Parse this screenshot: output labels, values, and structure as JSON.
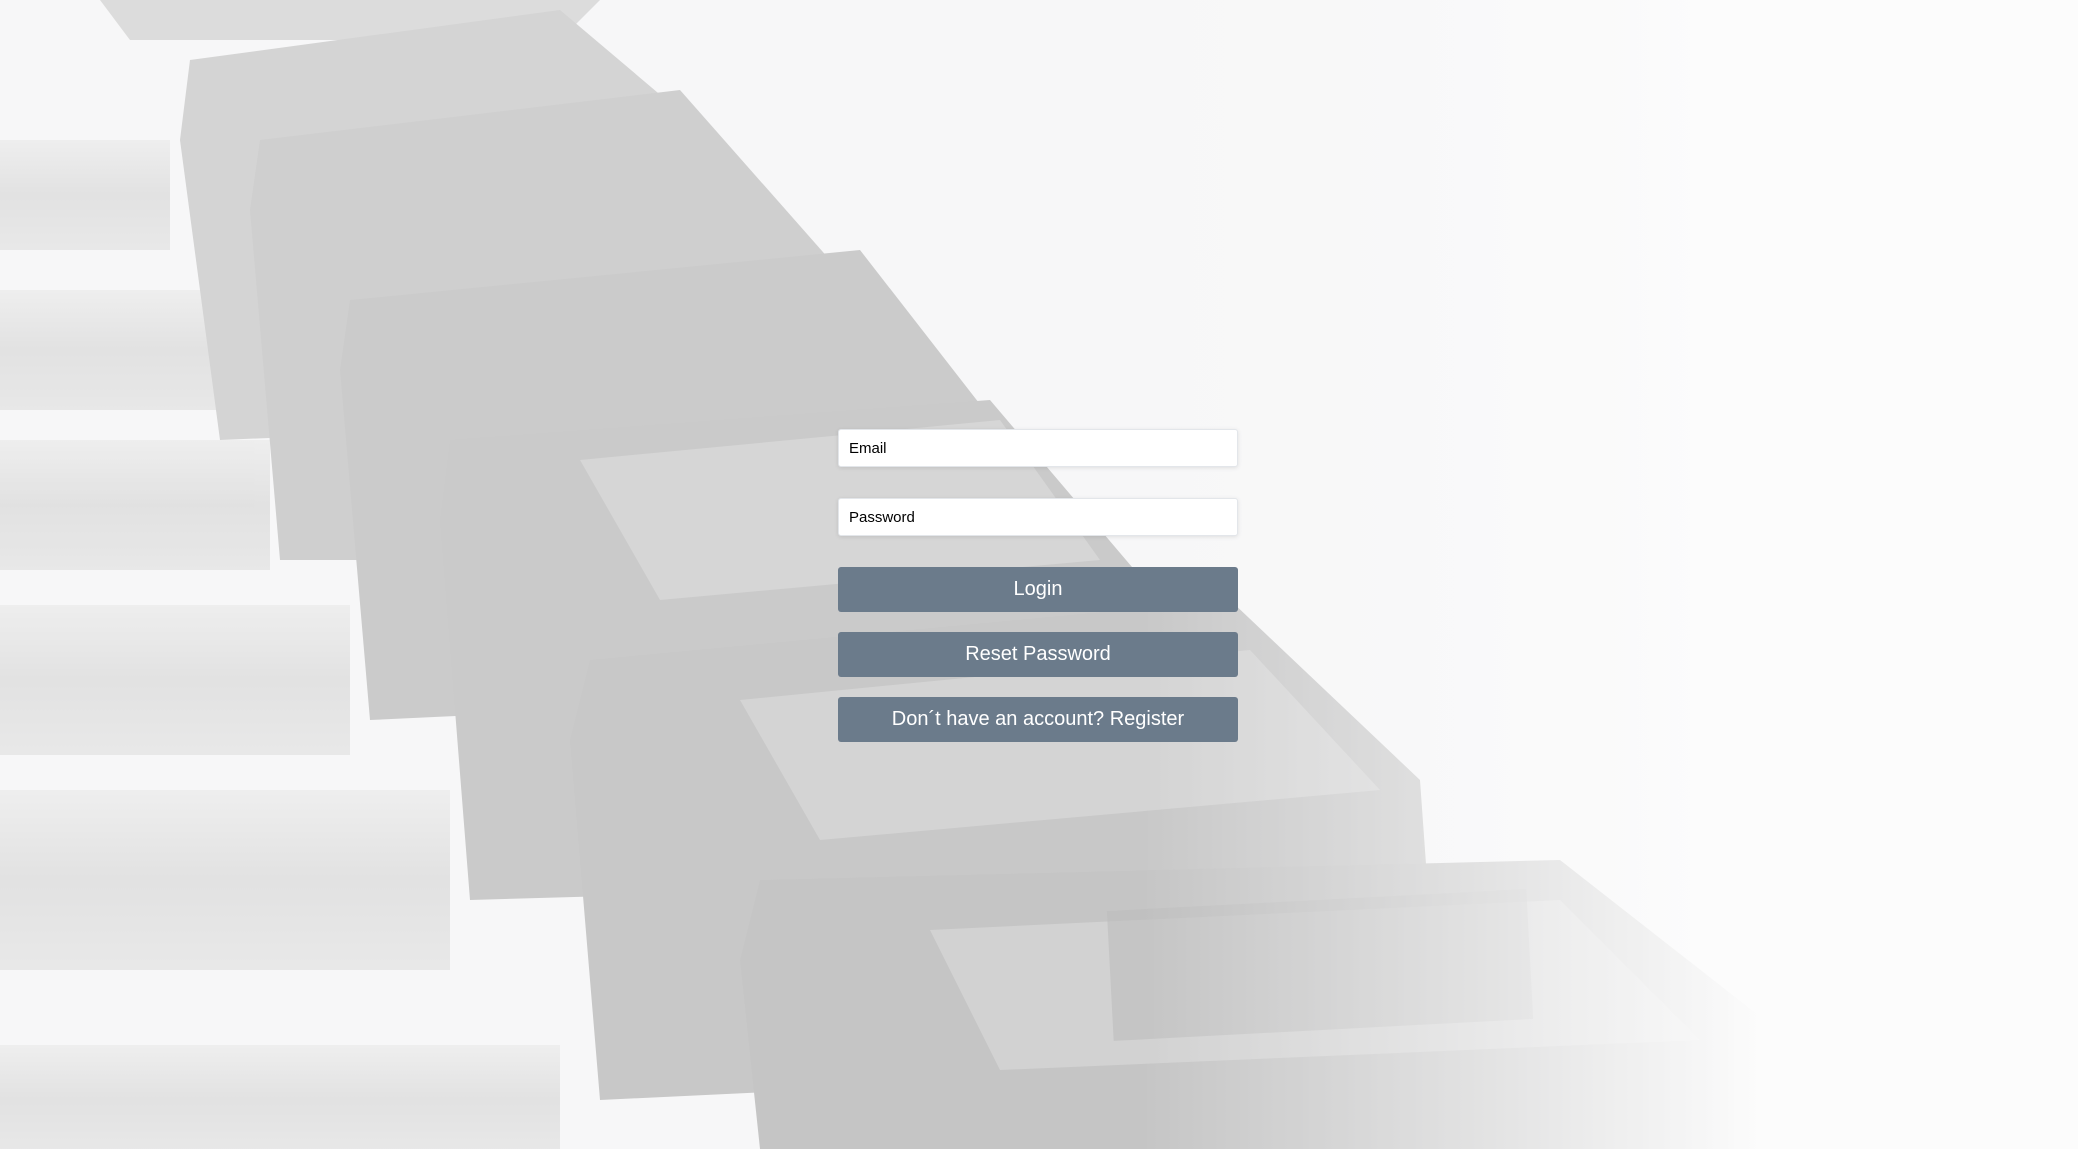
{
  "background": {
    "description_icon": "dumbbell-rack-photo",
    "tint_color": "#f6f6f7"
  },
  "form": {
    "email": {
      "placeholder": "Email",
      "value": ""
    },
    "password": {
      "placeholder": "Password",
      "value": ""
    },
    "login_label": "Login",
    "reset_label": "Reset Password",
    "register_label": "Don´t have an account? Register",
    "button_color": "#6b7b8b"
  }
}
